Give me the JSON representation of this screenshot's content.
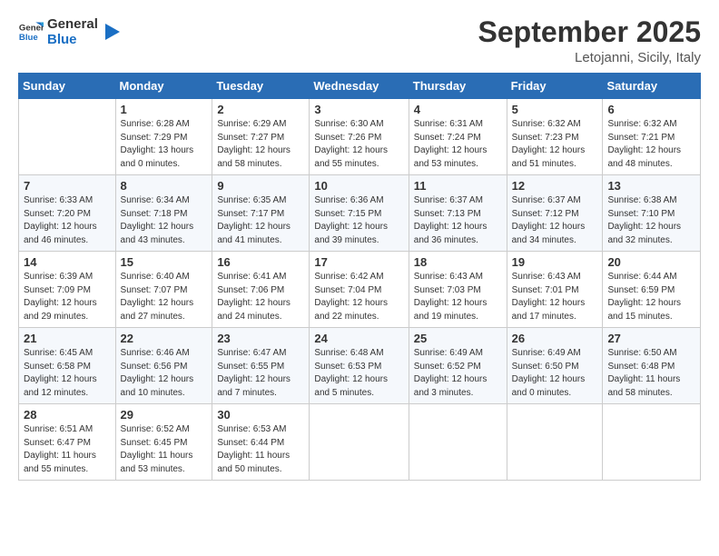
{
  "logo": {
    "line1": "General",
    "line2": "Blue"
  },
  "title": "September 2025",
  "subtitle": "Letojanni, Sicily, Italy",
  "days_header": [
    "Sunday",
    "Monday",
    "Tuesday",
    "Wednesday",
    "Thursday",
    "Friday",
    "Saturday"
  ],
  "weeks": [
    [
      {
        "day": "",
        "info": ""
      },
      {
        "day": "1",
        "info": "Sunrise: 6:28 AM\nSunset: 7:29 PM\nDaylight: 13 hours\nand 0 minutes."
      },
      {
        "day": "2",
        "info": "Sunrise: 6:29 AM\nSunset: 7:27 PM\nDaylight: 12 hours\nand 58 minutes."
      },
      {
        "day": "3",
        "info": "Sunrise: 6:30 AM\nSunset: 7:26 PM\nDaylight: 12 hours\nand 55 minutes."
      },
      {
        "day": "4",
        "info": "Sunrise: 6:31 AM\nSunset: 7:24 PM\nDaylight: 12 hours\nand 53 minutes."
      },
      {
        "day": "5",
        "info": "Sunrise: 6:32 AM\nSunset: 7:23 PM\nDaylight: 12 hours\nand 51 minutes."
      },
      {
        "day": "6",
        "info": "Sunrise: 6:32 AM\nSunset: 7:21 PM\nDaylight: 12 hours\nand 48 minutes."
      }
    ],
    [
      {
        "day": "7",
        "info": "Sunrise: 6:33 AM\nSunset: 7:20 PM\nDaylight: 12 hours\nand 46 minutes."
      },
      {
        "day": "8",
        "info": "Sunrise: 6:34 AM\nSunset: 7:18 PM\nDaylight: 12 hours\nand 43 minutes."
      },
      {
        "day": "9",
        "info": "Sunrise: 6:35 AM\nSunset: 7:17 PM\nDaylight: 12 hours\nand 41 minutes."
      },
      {
        "day": "10",
        "info": "Sunrise: 6:36 AM\nSunset: 7:15 PM\nDaylight: 12 hours\nand 39 minutes."
      },
      {
        "day": "11",
        "info": "Sunrise: 6:37 AM\nSunset: 7:13 PM\nDaylight: 12 hours\nand 36 minutes."
      },
      {
        "day": "12",
        "info": "Sunrise: 6:37 AM\nSunset: 7:12 PM\nDaylight: 12 hours\nand 34 minutes."
      },
      {
        "day": "13",
        "info": "Sunrise: 6:38 AM\nSunset: 7:10 PM\nDaylight: 12 hours\nand 32 minutes."
      }
    ],
    [
      {
        "day": "14",
        "info": "Sunrise: 6:39 AM\nSunset: 7:09 PM\nDaylight: 12 hours\nand 29 minutes."
      },
      {
        "day": "15",
        "info": "Sunrise: 6:40 AM\nSunset: 7:07 PM\nDaylight: 12 hours\nand 27 minutes."
      },
      {
        "day": "16",
        "info": "Sunrise: 6:41 AM\nSunset: 7:06 PM\nDaylight: 12 hours\nand 24 minutes."
      },
      {
        "day": "17",
        "info": "Sunrise: 6:42 AM\nSunset: 7:04 PM\nDaylight: 12 hours\nand 22 minutes."
      },
      {
        "day": "18",
        "info": "Sunrise: 6:43 AM\nSunset: 7:03 PM\nDaylight: 12 hours\nand 19 minutes."
      },
      {
        "day": "19",
        "info": "Sunrise: 6:43 AM\nSunset: 7:01 PM\nDaylight: 12 hours\nand 17 minutes."
      },
      {
        "day": "20",
        "info": "Sunrise: 6:44 AM\nSunset: 6:59 PM\nDaylight: 12 hours\nand 15 minutes."
      }
    ],
    [
      {
        "day": "21",
        "info": "Sunrise: 6:45 AM\nSunset: 6:58 PM\nDaylight: 12 hours\nand 12 minutes."
      },
      {
        "day": "22",
        "info": "Sunrise: 6:46 AM\nSunset: 6:56 PM\nDaylight: 12 hours\nand 10 minutes."
      },
      {
        "day": "23",
        "info": "Sunrise: 6:47 AM\nSunset: 6:55 PM\nDaylight: 12 hours\nand 7 minutes."
      },
      {
        "day": "24",
        "info": "Sunrise: 6:48 AM\nSunset: 6:53 PM\nDaylight: 12 hours\nand 5 minutes."
      },
      {
        "day": "25",
        "info": "Sunrise: 6:49 AM\nSunset: 6:52 PM\nDaylight: 12 hours\nand 3 minutes."
      },
      {
        "day": "26",
        "info": "Sunrise: 6:49 AM\nSunset: 6:50 PM\nDaylight: 12 hours\nand 0 minutes."
      },
      {
        "day": "27",
        "info": "Sunrise: 6:50 AM\nSunset: 6:48 PM\nDaylight: 11 hours\nand 58 minutes."
      }
    ],
    [
      {
        "day": "28",
        "info": "Sunrise: 6:51 AM\nSunset: 6:47 PM\nDaylight: 11 hours\nand 55 minutes."
      },
      {
        "day": "29",
        "info": "Sunrise: 6:52 AM\nSunset: 6:45 PM\nDaylight: 11 hours\nand 53 minutes."
      },
      {
        "day": "30",
        "info": "Sunrise: 6:53 AM\nSunset: 6:44 PM\nDaylight: 11 hours\nand 50 minutes."
      },
      {
        "day": "",
        "info": ""
      },
      {
        "day": "",
        "info": ""
      },
      {
        "day": "",
        "info": ""
      },
      {
        "day": "",
        "info": ""
      }
    ]
  ]
}
